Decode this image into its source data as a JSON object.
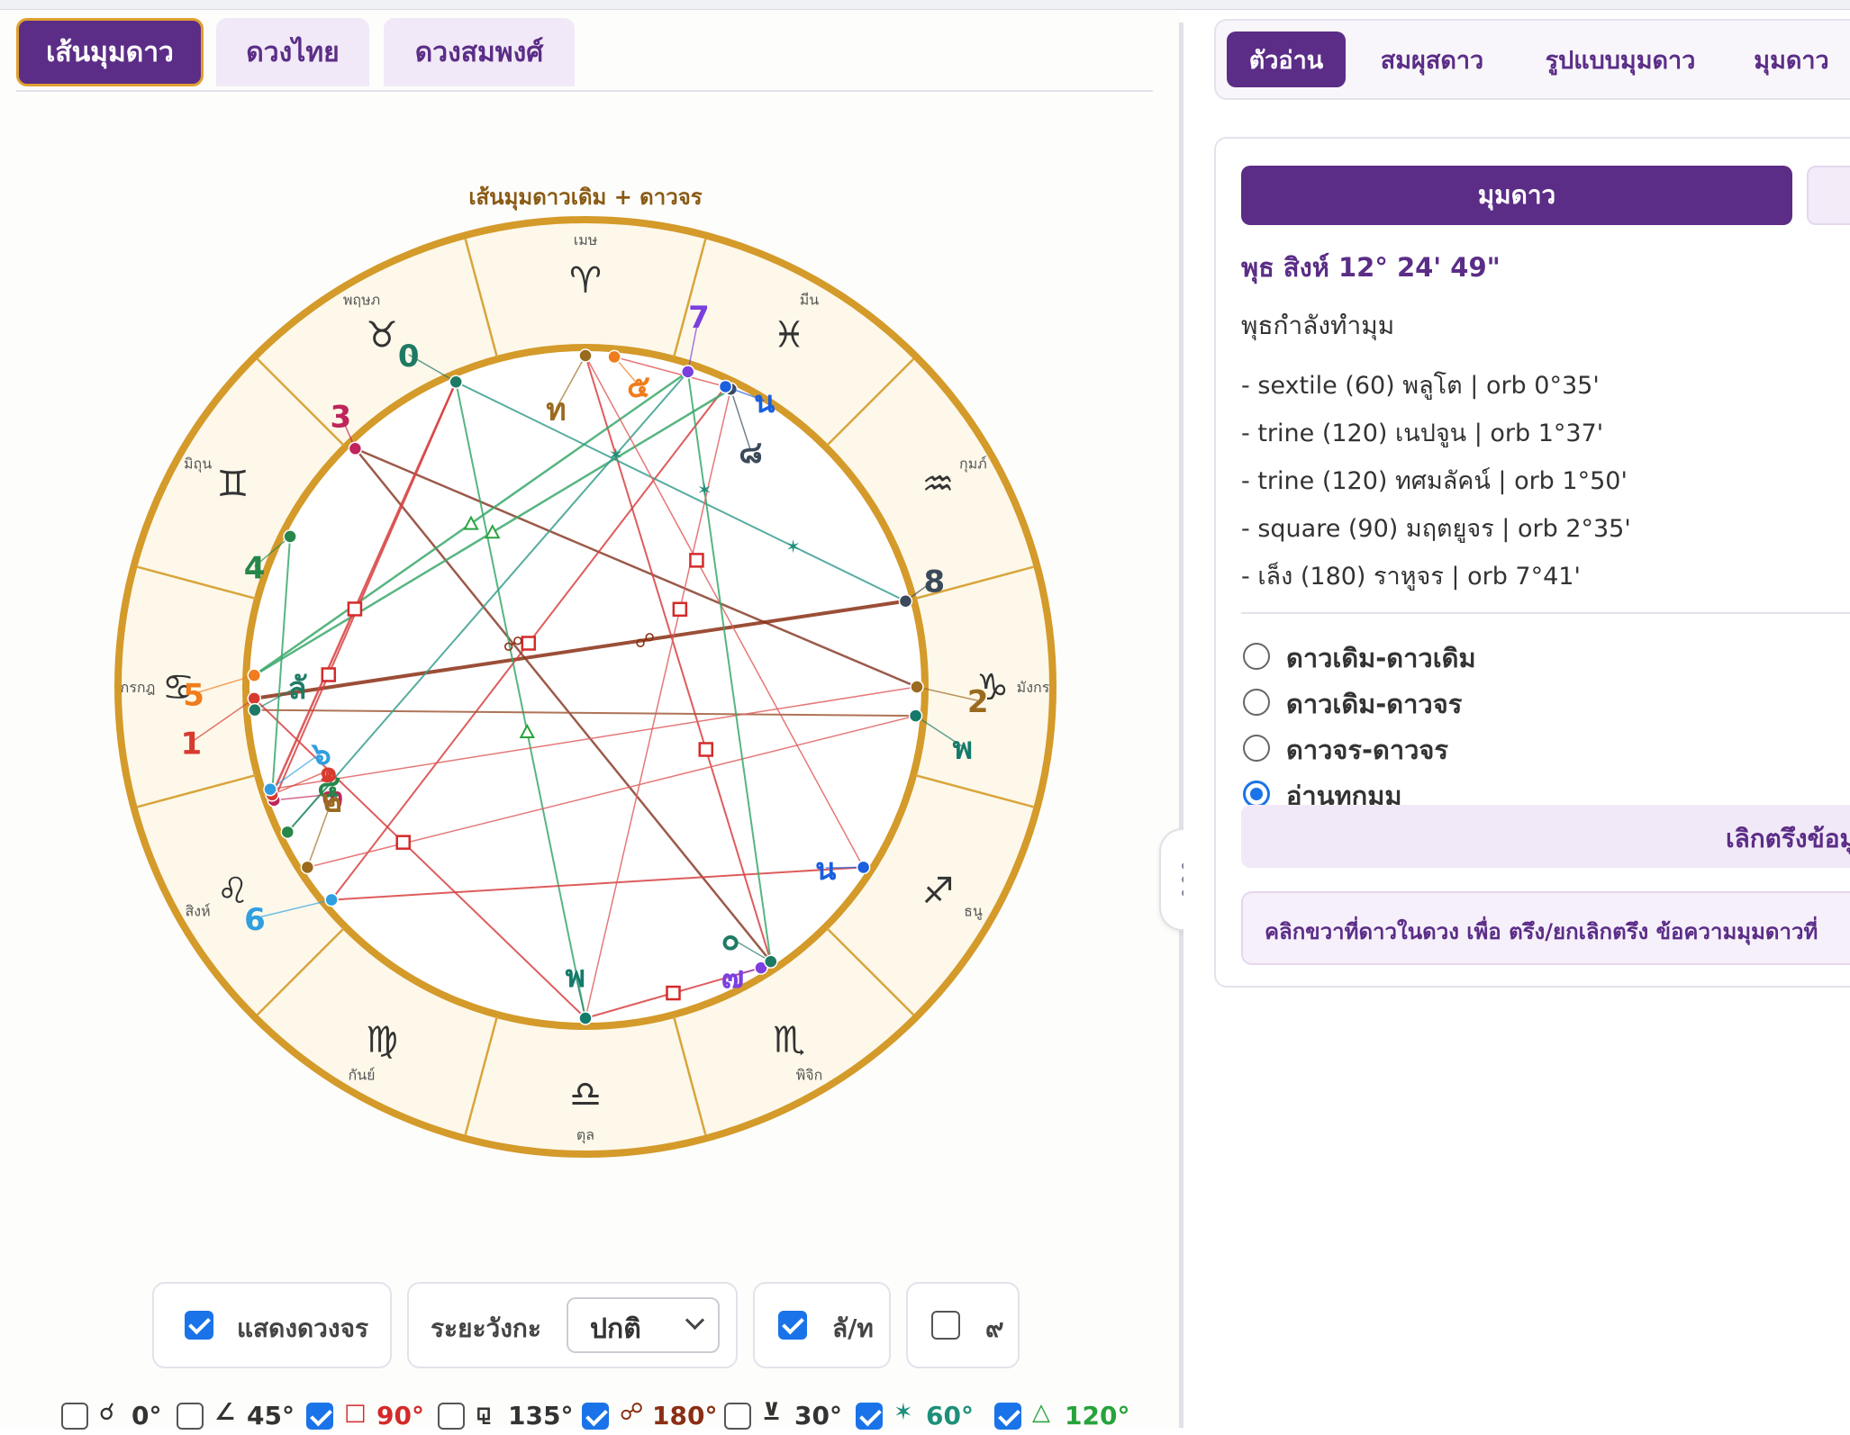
{
  "left_tabs": [
    "เส้นมุมดาว",
    "ดวงไทย",
    "ดวงสมพงศ์"
  ],
  "chart": {
    "title": "เส้นมุมดาวเดิม + ดาวจร",
    "signs": [
      {
        "name": "เมษ",
        "glyph": "♈"
      },
      {
        "name": "พฤษภ",
        "glyph": "♉"
      },
      {
        "name": "มิถุน",
        "glyph": "♊"
      },
      {
        "name": "กรกฎ",
        "glyph": "♋"
      },
      {
        "name": "สิงห์",
        "glyph": "♌"
      },
      {
        "name": "กันย์",
        "glyph": "♍"
      },
      {
        "name": "ตุล",
        "glyph": "♎"
      },
      {
        "name": "พิจิก",
        "glyph": "♏"
      },
      {
        "name": "ธนู",
        "glyph": "♐"
      },
      {
        "name": "มังกร",
        "glyph": "♑"
      },
      {
        "name": "กุมภ์",
        "glyph": "♒"
      },
      {
        "name": "มีน",
        "glyph": "♓"
      }
    ],
    "planets": [
      {
        "label": "0",
        "color": "#1f7a64"
      },
      {
        "label": "3",
        "color": "#c0245c"
      },
      {
        "label": "4",
        "color": "#27864a"
      },
      {
        "label": "5",
        "color": "#f07c1c"
      },
      {
        "label": "1",
        "color": "#d83a2f"
      },
      {
        "label": "ลั",
        "color": "#1f7a64"
      },
      {
        "label": "6",
        "color": "#2f9fe0"
      },
      {
        "label": "๓",
        "color": "#c0245c"
      },
      {
        "label": "๑",
        "color": "#d83a2f"
      },
      {
        "label": "๖",
        "color": "#2f9fe0"
      },
      {
        "label": "๔",
        "color": "#27864a"
      },
      {
        "label": "๒",
        "color": "#9a6a1e"
      },
      {
        "label": "พ",
        "color": "#157a6a"
      },
      {
        "label": "๗",
        "color": "#7b3fe0"
      },
      {
        "label": "๐",
        "color": "#1f7a64"
      },
      {
        "label": "น",
        "color": "#1a5fe0"
      },
      {
        "label": "พ",
        "color": "#157a6a"
      },
      {
        "label": "2",
        "color": "#9a6a1e"
      },
      {
        "label": "8",
        "color": "#3a4a5a"
      },
      {
        "label": "๘",
        "color": "#3a4a5a"
      },
      {
        "label": "น",
        "color": "#1a5fe0"
      },
      {
        "label": "7",
        "color": "#7b3fe0"
      },
      {
        "label": "ท",
        "color": "#9a6a1e"
      },
      {
        "label": "๕",
        "color": "#f07c1c"
      }
    ]
  },
  "controls": {
    "show_transit_label": "แสดงดวงจร",
    "show_transit_checked": true,
    "range_label": "ระยะวังกะ",
    "range_value": "ปกติ",
    "la_label": "ลั/ท",
    "la_checked": true,
    "nine_label": "๙",
    "nine_checked": false
  },
  "aspect_filters": [
    {
      "symbol": "☌",
      "degree": "0°",
      "checked": false,
      "color": "#333333"
    },
    {
      "symbol": "∠",
      "degree": "45°",
      "checked": false,
      "color": "#333333"
    },
    {
      "symbol": "□",
      "degree": "90°",
      "checked": true,
      "color": "#d42a2a"
    },
    {
      "symbol": "⚼",
      "degree": "135°",
      "checked": false,
      "color": "#333333"
    },
    {
      "symbol": "☍",
      "degree": "180°",
      "checked": true,
      "color": "#8a2f14"
    },
    {
      "symbol": "⊻",
      "degree": "30°",
      "checked": false,
      "color": "#333333"
    },
    {
      "symbol": "✶",
      "degree": "60°",
      "checked": true,
      "color": "#1d8f7a"
    },
    {
      "symbol": "△",
      "degree": "120°",
      "checked": true,
      "color": "#27a33c"
    }
  ],
  "right_tabs": [
    "ตัวอ่าน",
    "สมผุสดาว",
    "รูปแบบมุมดาว",
    "มุมดาว"
  ],
  "panel": {
    "button": "มุมดาว",
    "planet_heading": "พุธ สิงห์ 12° 24' 49\"",
    "making_text": "พุธกำลังทำมุม",
    "aspects": [
      "- sextile (60) พลูโต | orb 0°35'",
      "- trine (120) เนปจูน | orb 1°37'",
      "- trine (120) ทศมลัคน์ | orb 1°50'",
      "- square (90) มฤตยูจร | orb 2°35'",
      "- เล็ง (180) ราหูจร | orb 7°41'"
    ],
    "modes": [
      {
        "label": "ดาวเดิม-ดาวเดิม",
        "selected": false
      },
      {
        "label": "ดาวเดิม-ดาวจร",
        "selected": false
      },
      {
        "label": "ดาวจร-ดาวจร",
        "selected": false
      },
      {
        "label": "อ่านทุกมุม",
        "selected": true
      }
    ],
    "cancel_label": "เลิกตรึงข้อมู",
    "hint": "คลิกขวาที่ดาวในดวง เพื่อ ตรึง/ยกเลิกตรึง ข้อความมุมดาวที่"
  }
}
